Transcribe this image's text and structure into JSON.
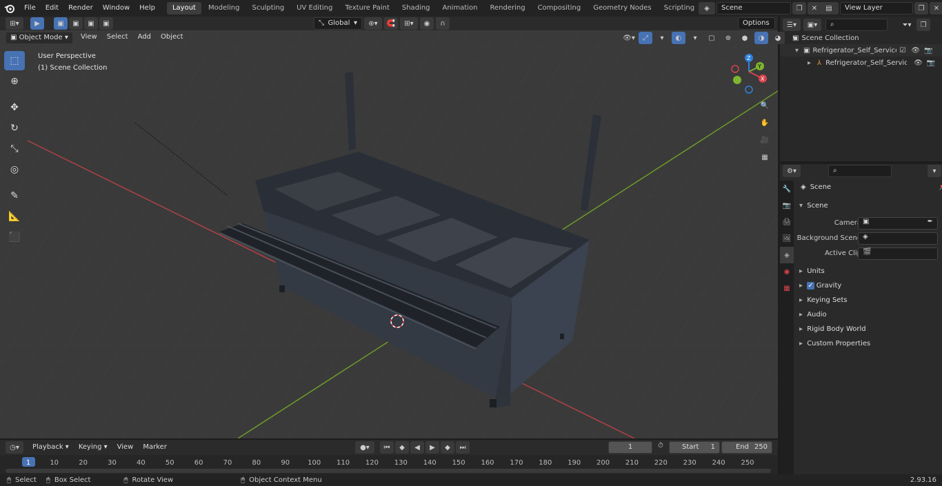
{
  "menu": [
    "File",
    "Edit",
    "Render",
    "Window",
    "Help"
  ],
  "workspaces": [
    "Layout",
    "Modeling",
    "Sculpting",
    "UV Editing",
    "Texture Paint",
    "Shading",
    "Animation",
    "Rendering",
    "Compositing",
    "Geometry Nodes",
    "Scripting"
  ],
  "active_workspace": "Layout",
  "scene_field": "Scene",
  "view_layer_field": "View Layer",
  "viewport": {
    "transform_orientation": "Global",
    "options_label": "Options",
    "mode": "Object Mode",
    "menus": [
      "View",
      "Select",
      "Add",
      "Object"
    ],
    "overlay_line1": "User Perspective",
    "overlay_line2": "(1) Scene Collection"
  },
  "gizmo": {
    "z": "Z",
    "y": "Y",
    "x": "X"
  },
  "outliner": {
    "root": "Scene Collection",
    "items": [
      "Refrigerator_Self_Service_Lin",
      "Refrigerator_Self_Service"
    ]
  },
  "properties": {
    "title": "Scene",
    "section": "Scene",
    "camera_label": "Camera",
    "background_label": "Background Scene",
    "clip_label": "Active Clip",
    "panels": [
      "Units",
      "Gravity",
      "Keying Sets",
      "Audio",
      "Rigid Body World",
      "Custom Properties"
    ]
  },
  "timeline": {
    "menus": [
      "Playback",
      "Keying",
      "View",
      "Marker"
    ],
    "current_frame": "1",
    "start_label": "Start",
    "start_value": "1",
    "end_label": "End",
    "end_value": "250",
    "ticks": [
      "1",
      "10",
      "20",
      "30",
      "40",
      "50",
      "60",
      "70",
      "80",
      "90",
      "100",
      "110",
      "120",
      "130",
      "140",
      "150",
      "160",
      "170",
      "180",
      "190",
      "200",
      "210",
      "220",
      "230",
      "240",
      "250"
    ]
  },
  "status": {
    "select": "Select",
    "box_select": "Box Select",
    "rotate": "Rotate View",
    "context": "Object Context Menu",
    "version": "2.93.16"
  },
  "colors": {
    "accent": "#4772b3",
    "x_axis": "#d8424f",
    "y_axis": "#7fb430",
    "z_axis": "#2d82e0"
  }
}
